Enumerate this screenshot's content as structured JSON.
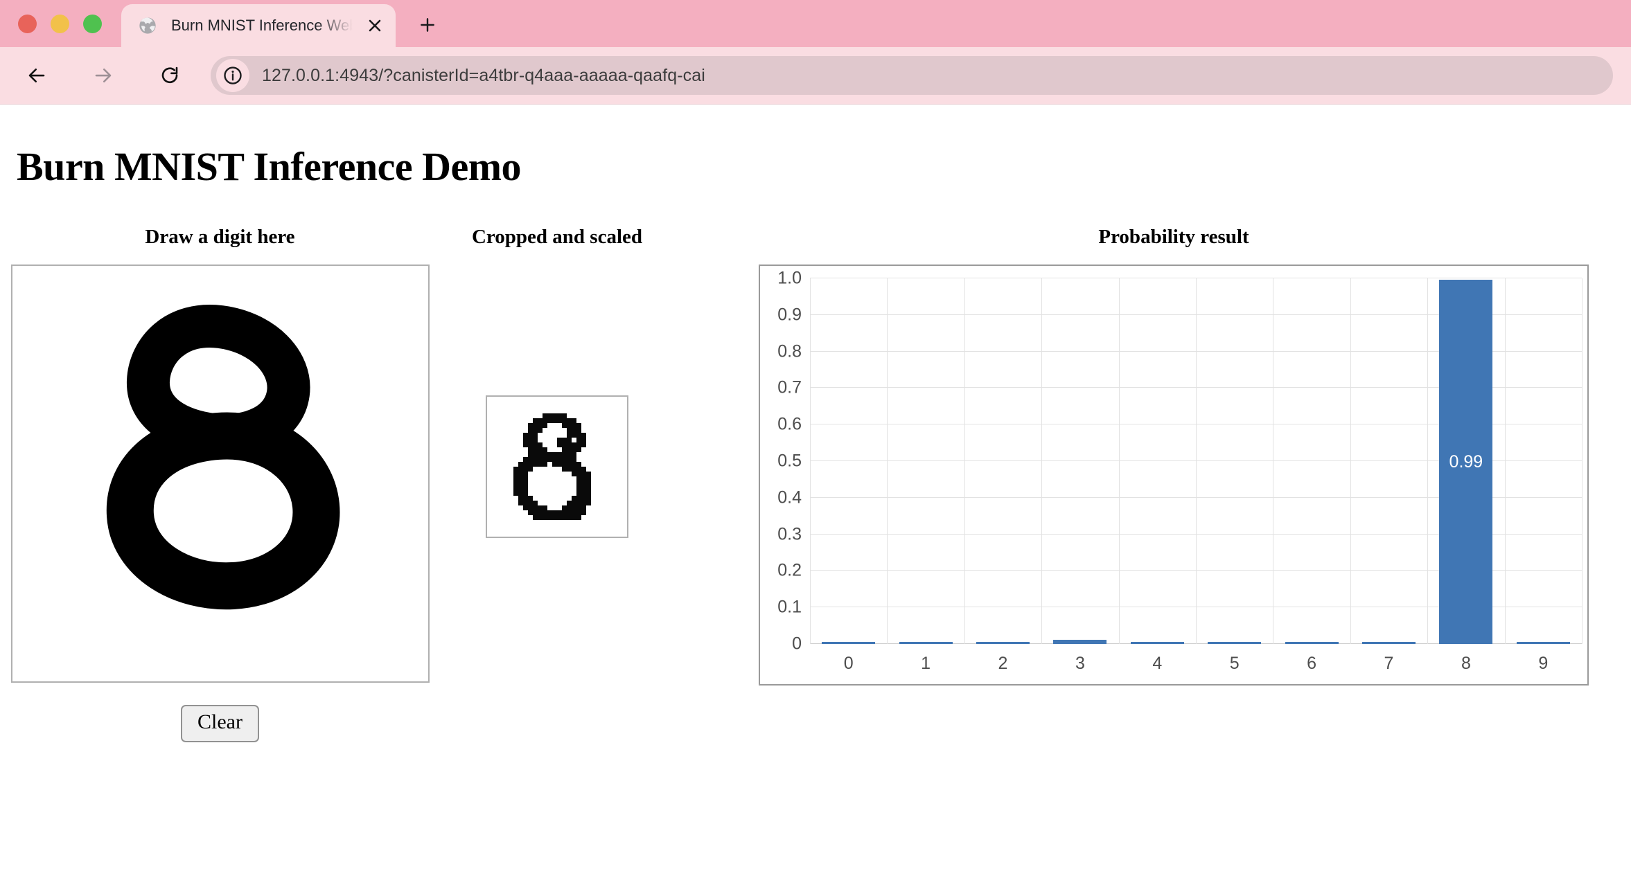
{
  "browser": {
    "traffic_lights": [
      {
        "name": "close",
        "color": "#e8635a"
      },
      {
        "name": "minimize",
        "color": "#f2c14a"
      },
      {
        "name": "maximize",
        "color": "#4fc14f"
      }
    ],
    "tab": {
      "title": "Burn MNIST Inference Web De",
      "favicon": "globe-icon",
      "close_label": "×"
    },
    "new_tab_label": "+",
    "nav": {
      "back_label": "←",
      "forward_label": "→",
      "reload_label": "⟳"
    },
    "omnibox": {
      "url": "127.0.0.1:4943/?canisterId=a4tbr-q4aaa-aaaaa-qaafq-cai",
      "site_info_icon": "info-circle-icon"
    }
  },
  "page": {
    "title": "Burn MNIST Inference Demo",
    "panels": {
      "draw": {
        "heading": "Draw a digit here",
        "clear_button": "Clear"
      },
      "crop": {
        "heading": "Cropped and scaled"
      },
      "chart": {
        "heading": "Probability result"
      }
    }
  },
  "chart_data": {
    "type": "bar",
    "title": "Probability result",
    "xlabel": "",
    "ylabel": "",
    "categories": [
      "0",
      "1",
      "2",
      "3",
      "4",
      "5",
      "6",
      "7",
      "8",
      "9"
    ],
    "values": [
      0.0,
      0.0,
      0.0,
      0.005,
      0.0,
      0.0,
      0.0,
      0.0,
      0.99,
      0.0
    ],
    "labels": [
      "",
      "",
      "",
      "",
      "",
      "",
      "",
      "",
      "0.99",
      ""
    ],
    "ylim": [
      0,
      1.0
    ],
    "yticks": [
      "0",
      "0.1",
      "0.2",
      "0.3",
      "0.4",
      "0.5",
      "0.6",
      "0.7",
      "0.8",
      "0.9",
      "1.0"
    ],
    "ytick_values": [
      0,
      0.1,
      0.2,
      0.3,
      0.4,
      0.5,
      0.6,
      0.7,
      0.8,
      0.9,
      1.0
    ],
    "grid": true,
    "legend": "none",
    "bar_color": "#4076b4",
    "bar_label_color": "#ffffff"
  }
}
